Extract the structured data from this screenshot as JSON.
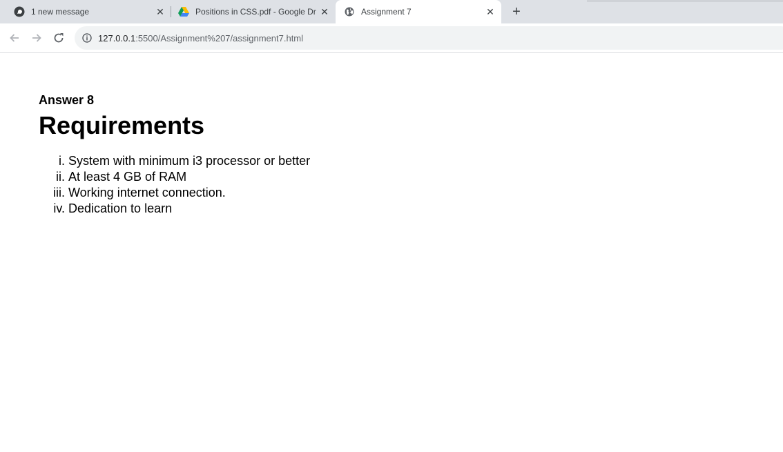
{
  "browser": {
    "tabs": [
      {
        "title": "1 new message",
        "icon": "whatsapp-icon",
        "active": false
      },
      {
        "title": "Positions in CSS.pdf - Google Dr",
        "icon": "google-drive-icon",
        "active": false
      },
      {
        "title": "Assignment 7",
        "icon": "globe-icon",
        "active": true
      }
    ],
    "new_tab_label": "+",
    "address": {
      "host": "127.0.0.1",
      "path": ":5500/Assignment%207/assignment7.html"
    }
  },
  "page": {
    "answer_heading": "Answer 8",
    "title": "Requirements",
    "items": [
      {
        "num": "i.",
        "text": "System with minimum i3 processor or better"
      },
      {
        "num": "ii.",
        "text": "At least 4 GB of RAM"
      },
      {
        "num": "iii.",
        "text": "Working internet connection."
      },
      {
        "num": "iv.",
        "text": "Dedication to learn"
      }
    ]
  }
}
